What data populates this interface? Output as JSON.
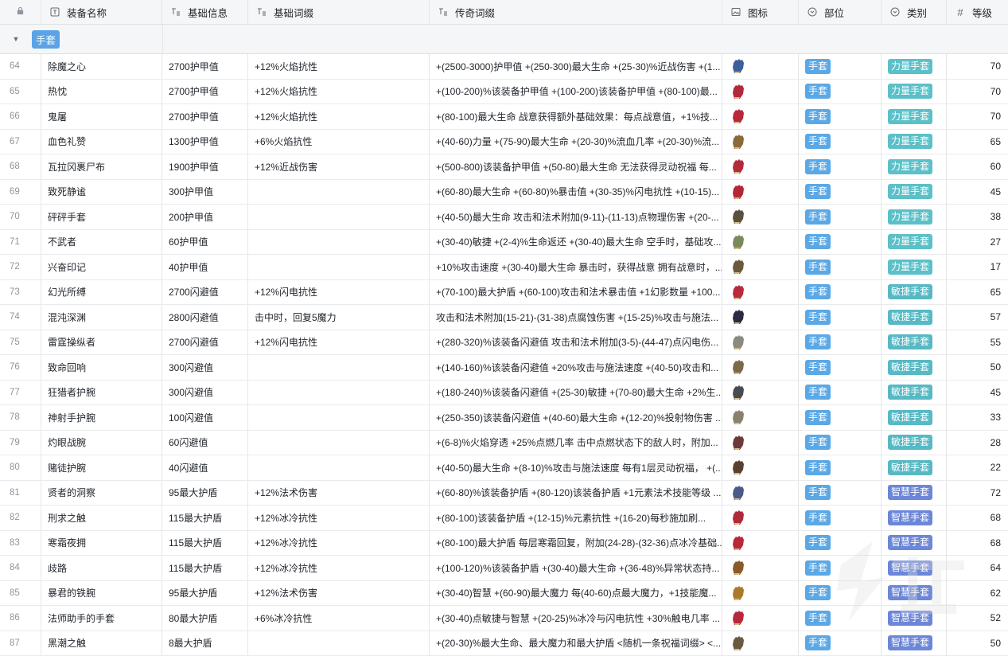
{
  "headers": {
    "name": "装备名称",
    "info": "基础信息",
    "base": "基础词缀",
    "legend": "传奇词缀",
    "icon": "图标",
    "slot": "部位",
    "type": "类别",
    "level": "等级"
  },
  "group": {
    "label": "手套"
  },
  "rows": [
    {
      "idx": "64",
      "name": "除魔之心",
      "info": "2700护甲值",
      "base": "+12%火焰抗性",
      "legend": "+(2500-3000)护甲值 +(250-300)最大生命 +(25-30)%近战伤害 +(1...",
      "slot": "手套",
      "type": "力量手套",
      "level": "70",
      "color": "#3e5e9e",
      "kind": "str"
    },
    {
      "idx": "65",
      "name": "热忱",
      "info": "2700护甲值",
      "base": "+12%火焰抗性",
      "legend": "+(100-200)%该装备护甲值 +(100-200)该装备护甲值 +(80-100)最...",
      "slot": "手套",
      "type": "力量手套",
      "level": "70",
      "color": "#b02a3c",
      "kind": "str"
    },
    {
      "idx": "66",
      "name": "鬼屠",
      "info": "2700护甲值",
      "base": "+12%火焰抗性",
      "legend": "+(80-100)最大生命 战意获得额外基础效果：每点战意值，+1%技...",
      "slot": "手套",
      "type": "力量手套",
      "level": "70",
      "color": "#b8283a",
      "kind": "str"
    },
    {
      "idx": "67",
      "name": "血色礼赞",
      "info": "1300护甲值",
      "base": "+6%火焰抗性",
      "legend": "+(40-60)力量 +(75-90)最大生命 +(20-30)%流血几率 +(20-30)%流...",
      "slot": "手套",
      "type": "力量手套",
      "level": "65",
      "color": "#8a6a3a",
      "kind": "str"
    },
    {
      "idx": "68",
      "name": "瓦拉冈裹尸布",
      "info": "1900护甲值",
      "base": "+12%近战伤害",
      "legend": "+(500-800)该装备护甲值 +(50-80)最大生命 无法获得灵动祝福 每...",
      "slot": "手套",
      "type": "力量手套",
      "level": "60",
      "color": "#b52a3a",
      "kind": "str"
    },
    {
      "idx": "69",
      "name": "致死静谧",
      "info": "300护甲值",
      "base": "",
      "legend": "+(60-80)最大生命 +(60-80)%暴击值 +(30-35)%闪电抗性 +(10-15)...",
      "slot": "手套",
      "type": "力量手套",
      "level": "45",
      "color": "#b32638",
      "kind": "str"
    },
    {
      "idx": "70",
      "name": "砰砰手套",
      "info": "200护甲值",
      "base": "",
      "legend": "+(40-50)最大生命 攻击和法术附加(9-11)-(11-13)点物理伤害 +(20-...",
      "slot": "手套",
      "type": "力量手套",
      "level": "38",
      "color": "#5a5040",
      "kind": "str"
    },
    {
      "idx": "71",
      "name": "不武者",
      "info": "60护甲值",
      "base": "",
      "legend": "+(30-40)敏捷 +(2-4)%生命返还 +(30-40)最大生命 空手时，基础攻...",
      "slot": "手套",
      "type": "力量手套",
      "level": "27",
      "color": "#7a8a5a",
      "kind": "str"
    },
    {
      "idx": "72",
      "name": "兴奋印记",
      "info": "40护甲值",
      "base": "",
      "legend": "+10%攻击速度 +(30-40)最大生命 暴击时，获得战意 拥有战意时，...",
      "slot": "手套",
      "type": "力量手套",
      "level": "17",
      "color": "#6a5a3a",
      "kind": "str"
    },
    {
      "idx": "73",
      "name": "幻光所缚",
      "info": "2700闪避值",
      "base": "+12%闪电抗性",
      "legend": "+(70-100)最大护盾 +(60-100)攻击和法术暴击值 +1幻影数量 +100...",
      "slot": "手套",
      "type": "敏捷手套",
      "level": "65",
      "color": "#b82a3c",
      "kind": "dex"
    },
    {
      "idx": "74",
      "name": "混沌深渊",
      "info": "2800闪避值",
      "base": "击中时，回复5魔力",
      "legend": "攻击和法术附加(15-21)-(31-38)点腐蚀伤害 +(15-25)%攻击与施法...",
      "slot": "手套",
      "type": "敏捷手套",
      "level": "57",
      "color": "#2a2a44",
      "kind": "dex"
    },
    {
      "idx": "75",
      "name": "雷霆操纵者",
      "info": "2700闪避值",
      "base": "+12%闪电抗性",
      "legend": "+(280-320)%该装备闪避值 攻击和法术附加(3-5)-(44-47)点闪电伤...",
      "slot": "手套",
      "type": "敏捷手套",
      "level": "55",
      "color": "#8a8a80",
      "kind": "dex"
    },
    {
      "idx": "76",
      "name": "致命回响",
      "info": "300闪避值",
      "base": "",
      "legend": "+(140-160)%该装备闪避值 +20%攻击与施法速度 +(40-50)攻击和...",
      "slot": "手套",
      "type": "敏捷手套",
      "level": "50",
      "color": "#7a6a4a",
      "kind": "dex"
    },
    {
      "idx": "77",
      "name": "狂猎者护腕",
      "info": "300闪避值",
      "base": "",
      "legend": "+(180-240)%该装备闪避值 +(25-30)敏捷 +(70-80)最大生命 +2%生...",
      "slot": "手套",
      "type": "敏捷手套",
      "level": "45",
      "color": "#4a4a52",
      "kind": "dex"
    },
    {
      "idx": "78",
      "name": "神射手护腕",
      "info": "100闪避值",
      "base": "",
      "legend": "+(250-350)该装备闪避值 +(40-60)最大生命 +(12-20)%投射物伤害 ...",
      "slot": "手套",
      "type": "敏捷手套",
      "level": "33",
      "color": "#8a8070",
      "kind": "dex"
    },
    {
      "idx": "79",
      "name": "灼眼战腕",
      "info": "60闪避值",
      "base": "",
      "legend": "+(6-8)%火焰穿透 +25%点燃几率 击中点燃状态下的敌人时，附加...",
      "slot": "手套",
      "type": "敏捷手套",
      "level": "28",
      "color": "#6a3a3a",
      "kind": "dex"
    },
    {
      "idx": "80",
      "name": "赌徒护腕",
      "info": "40闪避值",
      "base": "",
      "legend": "+(40-50)最大生命 +(8-10)%攻击与施法速度 每有1层灵动祝福， +(...",
      "slot": "手套",
      "type": "敏捷手套",
      "level": "22",
      "color": "#5a4030",
      "kind": "dex"
    },
    {
      "idx": "81",
      "name": "贤者的洞察",
      "info": "95最大护盾",
      "base": "+12%法术伤害",
      "legend": "+(60-80)%该装备护盾 +(80-120)该装备护盾 +1元素法术技能等级 ...",
      "slot": "手套",
      "type": "智慧手套",
      "level": "72",
      "color": "#4a5a8a",
      "kind": "int"
    },
    {
      "idx": "82",
      "name": "刑求之触",
      "info": "115最大护盾",
      "base": "+12%冰冷抗性",
      "legend": "+(80-100)该装备护盾 +(12-15)%元素抗性 +(16-20)每秒施加刷...",
      "slot": "手套",
      "type": "智慧手套",
      "level": "68",
      "color": "#b02a3a",
      "kind": "int"
    },
    {
      "idx": "83",
      "name": "寒霜夜拥",
      "info": "115最大护盾",
      "base": "+12%冰冷抗性",
      "legend": "+(80-100)最大护盾 每层寒霜回复，附加(24-28)-(32-36)点冰冷基础...",
      "slot": "手套",
      "type": "智慧手套",
      "level": "68",
      "color": "#b8283a",
      "kind": "int"
    },
    {
      "idx": "84",
      "name": "歧路",
      "info": "115最大护盾",
      "base": "+12%冰冷抗性",
      "legend": "+(100-120)%该装备护盾 +(30-40)最大生命 +(36-48)%异常状态持...",
      "slot": "手套",
      "type": "智慧手套",
      "level": "64",
      "color": "#8a5a2a",
      "kind": "int"
    },
    {
      "idx": "85",
      "name": "暴君的铁腕",
      "info": "95最大护盾",
      "base": "+12%法术伤害",
      "legend": "+(30-40)智慧 +(60-90)最大魔力 每(40-60)点最大魔力，+1技能魔...",
      "slot": "手套",
      "type": "智慧手套",
      "level": "62",
      "color": "#a87a2a",
      "kind": "int"
    },
    {
      "idx": "86",
      "name": "法师助手的手套",
      "info": "80最大护盾",
      "base": "+6%冰冷抗性",
      "legend": "+(30-40)点敏捷与智慧 +(20-25)%冰冷与闪电抗性 +30%触电几率 ...",
      "slot": "手套",
      "type": "智慧手套",
      "level": "52",
      "color": "#b8283a",
      "kind": "int"
    },
    {
      "idx": "87",
      "name": "黑潮之触",
      "info": "8最大护盾",
      "base": "",
      "legend": "+(20-30)%最大生命、最大魔力和最大护盾 <随机一条祝福词缀> <...",
      "slot": "手套",
      "type": "智慧手套",
      "level": "50",
      "color": "#6a5a40",
      "kind": "int"
    }
  ]
}
